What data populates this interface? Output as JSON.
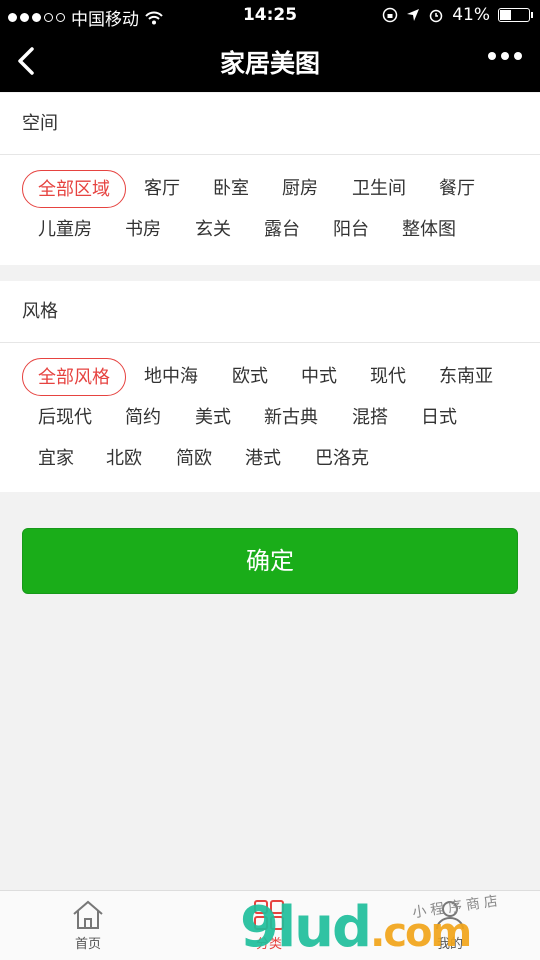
{
  "status_bar": {
    "carrier": "中国移动",
    "time": "14:25",
    "battery_text": "41%",
    "battery_level": 0.41,
    "signal_dots_filled": 3,
    "signal_dots_total": 5
  },
  "nav": {
    "title": "家居美图",
    "back_icon": "chevron-left-icon",
    "more_icon": "more-dots-icon"
  },
  "space": {
    "heading": "空间",
    "tags": [
      {
        "label": "全部区域",
        "active": true
      },
      {
        "label": "客厅",
        "active": false
      },
      {
        "label": "卧室",
        "active": false
      },
      {
        "label": "厨房",
        "active": false
      },
      {
        "label": "卫生间",
        "active": false
      },
      {
        "label": "餐厅",
        "active": false
      },
      {
        "label": "儿童房",
        "active": false
      },
      {
        "label": "书房",
        "active": false
      },
      {
        "label": "玄关",
        "active": false
      },
      {
        "label": "露台",
        "active": false
      },
      {
        "label": "阳台",
        "active": false
      },
      {
        "label": "整体图",
        "active": false
      }
    ]
  },
  "style": {
    "heading": "风格",
    "tags": [
      {
        "label": "全部风格",
        "active": true
      },
      {
        "label": "地中海",
        "active": false
      },
      {
        "label": "欧式",
        "active": false
      },
      {
        "label": "中式",
        "active": false
      },
      {
        "label": "现代",
        "active": false
      },
      {
        "label": "东南亚",
        "active": false
      },
      {
        "label": "后现代",
        "active": false
      },
      {
        "label": "简约",
        "active": false
      },
      {
        "label": "美式",
        "active": false
      },
      {
        "label": "新古典",
        "active": false
      },
      {
        "label": "混搭",
        "active": false
      },
      {
        "label": "日式",
        "active": false
      },
      {
        "label": "宜家",
        "active": false
      },
      {
        "label": "北欧",
        "active": false
      },
      {
        "label": "简欧",
        "active": false
      },
      {
        "label": "港式",
        "active": false
      },
      {
        "label": "巴洛克",
        "active": false
      }
    ]
  },
  "confirm_label": "确定",
  "tabbar": {
    "items": [
      {
        "label": "首页",
        "icon": "home-icon"
      },
      {
        "label": "分类",
        "icon": "category-grid-icon"
      },
      {
        "label": "我的",
        "icon": "user-icon"
      }
    ]
  },
  "watermark": {
    "text": "9lud",
    "suffix": ".com",
    "sub": "小程序商店"
  },
  "colors": {
    "accent_red": "#e64340",
    "confirm_green": "#1aad19",
    "nav_bg": "#000000",
    "page_bg": "#f2f2f2"
  }
}
